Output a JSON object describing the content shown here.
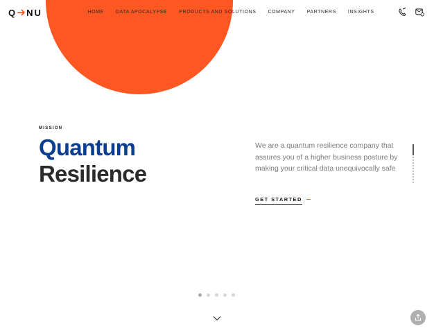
{
  "header": {
    "logo_left": "Q",
    "logo_right": "NU",
    "nav": [
      "HOME",
      "DATA APOCALYPSE",
      "PRODUCTS AND SOLUTIONS",
      "COMPANY",
      "PARTNERS",
      "INSIGHTS"
    ],
    "icons": [
      "phone-icon",
      "mail-icon"
    ]
  },
  "hero": {
    "eyebrow": "MISSION",
    "headline_line1": "Quantum",
    "headline_line2": "Resilience",
    "body": "We are a quantum resilience company that assures you of a higher business posture by making your critical data unequivocally safe",
    "cta_label": "GET STARTED"
  },
  "pager": {
    "total": 5,
    "active_index": 0
  },
  "colors": {
    "accent": "#ff5722",
    "headline_blue": "#0b3d91",
    "headline_dark": "#2a2a2a"
  }
}
